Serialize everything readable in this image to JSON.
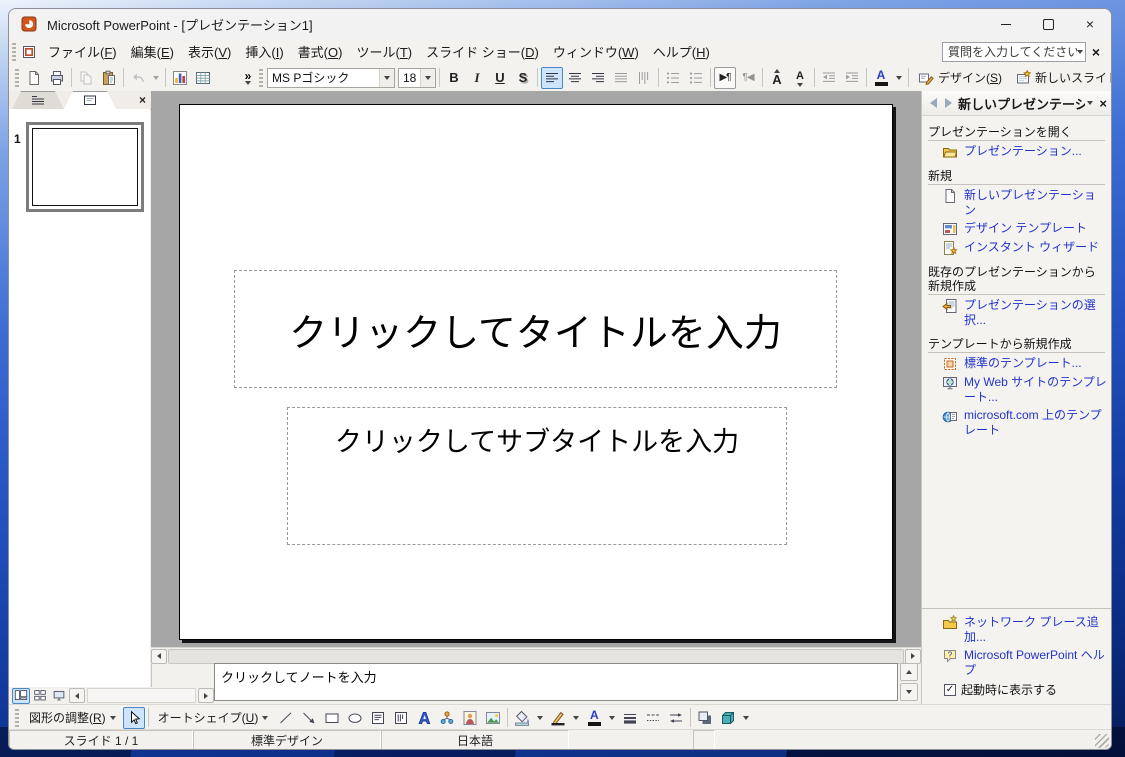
{
  "window": {
    "title": "Microsoft PowerPoint - [プレゼンテーション1]"
  },
  "glyphs": {
    "close": "×",
    "more": "»",
    "check": "✓",
    "question": "?"
  },
  "menu": {
    "question_placeholder": "質問を入力してください",
    "items": [
      {
        "name": "file",
        "label": "ファイル",
        "key": "F"
      },
      {
        "name": "edit",
        "label": "編集",
        "key": "E"
      },
      {
        "name": "view",
        "label": "表示",
        "key": "V"
      },
      {
        "name": "insert",
        "label": "挿入",
        "key": "I"
      },
      {
        "name": "format",
        "label": "書式",
        "key": "O"
      },
      {
        "name": "tools",
        "label": "ツール",
        "key": "T"
      },
      {
        "name": "slideshow",
        "label": "スライド ショー",
        "key": "D"
      },
      {
        "name": "window",
        "label": "ウィンドウ",
        "key": "W"
      },
      {
        "name": "help",
        "label": "ヘルプ",
        "key": "H"
      }
    ]
  },
  "standard_toolbar": {
    "items": [
      {
        "type": "grip"
      },
      {
        "type": "icon",
        "name": "new-document"
      },
      {
        "type": "icon",
        "name": "print"
      },
      {
        "type": "sep"
      },
      {
        "type": "icon",
        "name": "copy",
        "enabled": false
      },
      {
        "type": "icon",
        "name": "paste"
      },
      {
        "type": "sep"
      },
      {
        "type": "icon",
        "name": "undo",
        "enabled": false,
        "dd": true
      },
      {
        "type": "sep"
      },
      {
        "type": "icon",
        "name": "insert-chart"
      },
      {
        "type": "icon",
        "name": "insert-table"
      },
      {
        "type": "more",
        "glyph": "»"
      },
      {
        "type": "grip"
      },
      {
        "type": "combo",
        "name": "font-name",
        "value": "MS Pゴシック"
      },
      {
        "type": "combo",
        "name": "font-size",
        "value": "18"
      },
      {
        "type": "sep"
      },
      {
        "type": "glyph",
        "name": "bold",
        "glyph": "B",
        "cls": "gb"
      },
      {
        "type": "glyph",
        "name": "italic",
        "glyph": "I",
        "cls": "gi"
      },
      {
        "type": "glyph",
        "name": "underline",
        "glyph": "U",
        "cls": "gu"
      },
      {
        "type": "glyph",
        "name": "text-shadow",
        "glyph": "S",
        "cls": "gs"
      },
      {
        "type": "sep"
      },
      {
        "type": "icon",
        "name": "align-left",
        "active": true
      },
      {
        "type": "icon",
        "name": "align-center"
      },
      {
        "type": "icon",
        "name": "align-right"
      },
      {
        "type": "icon",
        "name": "distribute-text",
        "enabled": false
      },
      {
        "type": "icon",
        "name": "vertical-text",
        "enabled": false
      },
      {
        "type": "sep"
      },
      {
        "type": "icon",
        "name": "numbering",
        "enabled": false
      },
      {
        "type": "icon",
        "name": "bullets",
        "enabled": false
      },
      {
        "type": "sep"
      },
      {
        "type": "glyph",
        "name": "ltr-paragraph",
        "glyph": "▶¶",
        "cls": "gp",
        "framed": true
      },
      {
        "type": "glyph",
        "name": "rtl-paragraph",
        "glyph": "¶◀",
        "cls": "gp",
        "enabled": false
      },
      {
        "type": "sep"
      },
      {
        "type": "glyph",
        "name": "increase-font-size",
        "glyph": "A",
        "cls": "ga",
        "badge": "up"
      },
      {
        "type": "glyph",
        "name": "decrease-font-size",
        "glyph": "A",
        "cls": "ga sm",
        "badge": "down"
      },
      {
        "type": "sep"
      },
      {
        "type": "icon",
        "name": "decrease-indent",
        "enabled": false
      },
      {
        "type": "icon",
        "name": "increase-indent",
        "enabled": false
      },
      {
        "type": "sep"
      },
      {
        "type": "colorglyph",
        "name": "font-color",
        "glyph": "A",
        "dd": true
      },
      {
        "type": "sep"
      },
      {
        "type": "button",
        "name": "slide-design",
        "icon": "design-slide",
        "label": "デザイン",
        "key": "S"
      },
      {
        "type": "button",
        "name": "new-slide",
        "icon": "new-slide",
        "label": "新しいスライド",
        "key": "N"
      },
      {
        "type": "ddbtn",
        "name": "toolbar-options"
      }
    ]
  },
  "drawing_toolbar": {
    "items": [
      {
        "type": "grip"
      },
      {
        "type": "menu-button",
        "name": "draw-menu",
        "label": "図形の調整",
        "key": "R",
        "dd": true
      },
      {
        "type": "icon",
        "name": "select-objects",
        "active": true
      },
      {
        "type": "sep"
      },
      {
        "type": "menu-button",
        "name": "autoshapes-menu",
        "label": "オートシェイプ",
        "key": "U",
        "dd": true
      },
      {
        "type": "icon",
        "name": "line"
      },
      {
        "type": "icon",
        "name": "arrow"
      },
      {
        "type": "icon",
        "name": "rectangle"
      },
      {
        "type": "icon",
        "name": "oval"
      },
      {
        "type": "icon",
        "name": "text-box"
      },
      {
        "type": "icon",
        "name": "vertical-text-box"
      },
      {
        "type": "icon",
        "name": "insert-wordart"
      },
      {
        "type": "icon",
        "name": "insert-diagram"
      },
      {
        "type": "icon",
        "name": "insert-clip-art"
      },
      {
        "type": "icon",
        "name": "insert-picture"
      },
      {
        "type": "sep"
      },
      {
        "type": "icon",
        "name": "fill-color",
        "dd": true
      },
      {
        "type": "icon",
        "name": "line-color",
        "dd": true
      },
      {
        "type": "colorglyph",
        "name": "draw-font-color",
        "glyph": "A",
        "dd": true
      },
      {
        "type": "icon",
        "name": "line-style"
      },
      {
        "type": "icon",
        "name": "dash-style"
      },
      {
        "type": "icon",
        "name": "arrow-style"
      },
      {
        "type": "sep"
      },
      {
        "type": "icon",
        "name": "shadow-style"
      },
      {
        "type": "icon",
        "name": "three-d-style"
      },
      {
        "type": "ddbtn",
        "name": "drawbar-options"
      }
    ]
  },
  "view_buttons": [
    {
      "name": "normal-view",
      "active": true
    },
    {
      "name": "slide-sorter-view",
      "active": false
    },
    {
      "name": "slide-show-view",
      "active": false
    }
  ],
  "thumbnail_panel": {
    "slide_number": "1"
  },
  "slide": {
    "title_placeholder": "クリックしてタイトルを入力",
    "subtitle_placeholder": "クリックしてサブタイトルを入力"
  },
  "notes": {
    "placeholder": "クリックしてノートを入力"
  },
  "task_pane": {
    "title": "新しいプレゼンテーション",
    "sections": [
      {
        "header": "プレゼンテーションを開く",
        "links": [
          {
            "icon": "open-presentation",
            "label": "プレゼンテーション..."
          }
        ]
      },
      {
        "header": "新規",
        "links": [
          {
            "icon": "blank-presentation",
            "label": "新しいプレゼンテーション"
          },
          {
            "icon": "design-template",
            "label": "デザイン テンプレート"
          },
          {
            "icon": "autocontent-wizard",
            "label": "インスタント ウィザード"
          }
        ]
      },
      {
        "header": "既存のプレゼンテーションから新規作成",
        "links": [
          {
            "icon": "choose-presentation",
            "label": "プレゼンテーションの選択..."
          }
        ]
      },
      {
        "header": "テンプレートから新規作成",
        "links": [
          {
            "icon": "general-templates",
            "label": "標準のテンプレート..."
          },
          {
            "icon": "web-site-templates",
            "label": "My Web サイトのテンプレート..."
          },
          {
            "icon": "microsoft-templates",
            "label": "microsoft.com 上のテンプレート"
          }
        ]
      }
    ],
    "footer_links": [
      {
        "icon": "add-network-place",
        "label": "ネットワーク プレース追加..."
      },
      {
        "icon": "powerpoint-help",
        "label": "Microsoft PowerPoint ヘルプ"
      }
    ],
    "startup_label": "起動時に表示する",
    "startup_checked": true
  },
  "status_bar": {
    "slide_indicator": "スライド 1 / 1",
    "design_name": "標準デザイン",
    "language": "日本語"
  },
  "colors": {
    "link_blue": "#2233cc",
    "workspace_gray": "#a6a6a6",
    "selection_blue": "#4a86c8",
    "titlebar_bg": "#f2f2f2",
    "wallpaper_blue": "#2250bd"
  }
}
